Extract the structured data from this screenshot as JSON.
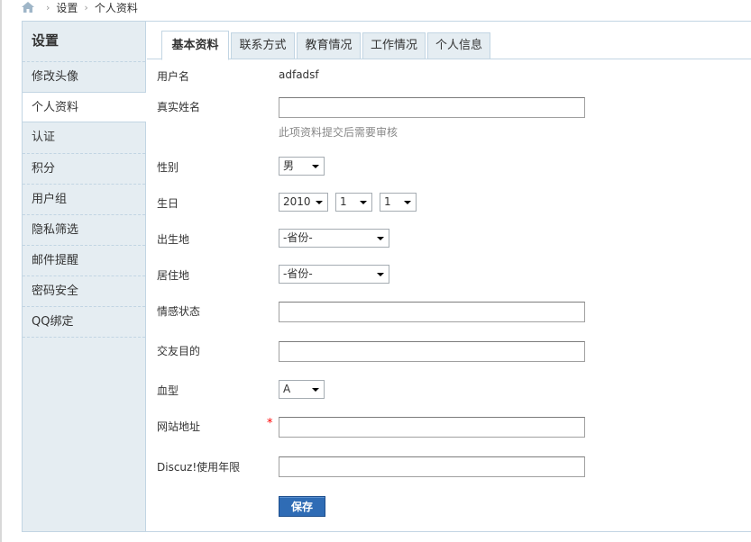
{
  "breadcrumb": {
    "home_icon": "home-icon",
    "items": [
      "设置",
      "个人资料"
    ],
    "sep": "›"
  },
  "sidebar": {
    "title": "设置",
    "items": [
      "修改头像",
      "个人资料",
      "认证",
      "积分",
      "用户组",
      "隐私筛选",
      "邮件提醒",
      "密码安全",
      "QQ绑定"
    ],
    "active_index": 1
  },
  "tabs": [
    "基本资料",
    "联系方式",
    "教育情况",
    "工作情况",
    "个人信息"
  ],
  "form": {
    "username": {
      "label": "用户名",
      "value": "adfadsf"
    },
    "realname": {
      "label": "真实姓名",
      "value": "",
      "hint": "此项资料提交后需要审核"
    },
    "gender": {
      "label": "性别",
      "value": "男"
    },
    "birthday": {
      "label": "生日",
      "year": "2010",
      "month": "1",
      "day": "1"
    },
    "birthplace": {
      "label": "出生地",
      "value": "-省份-"
    },
    "residence": {
      "label": "居住地",
      "value": "-省份-"
    },
    "affective": {
      "label": "情感状态",
      "value": ""
    },
    "purpose": {
      "label": "交友目的",
      "value": ""
    },
    "bloodtype": {
      "label": "血型",
      "value": "A"
    },
    "website": {
      "label": "网站地址",
      "value": "",
      "required_mark": "*"
    },
    "years": {
      "label": "Discuz!使用年限",
      "value": ""
    },
    "save_label": "保存"
  },
  "colors": {
    "accent": "#2f6cb5",
    "sidebar_bg": "#e5edf2",
    "border": "#c2d5e3",
    "required": "#ff0000"
  }
}
